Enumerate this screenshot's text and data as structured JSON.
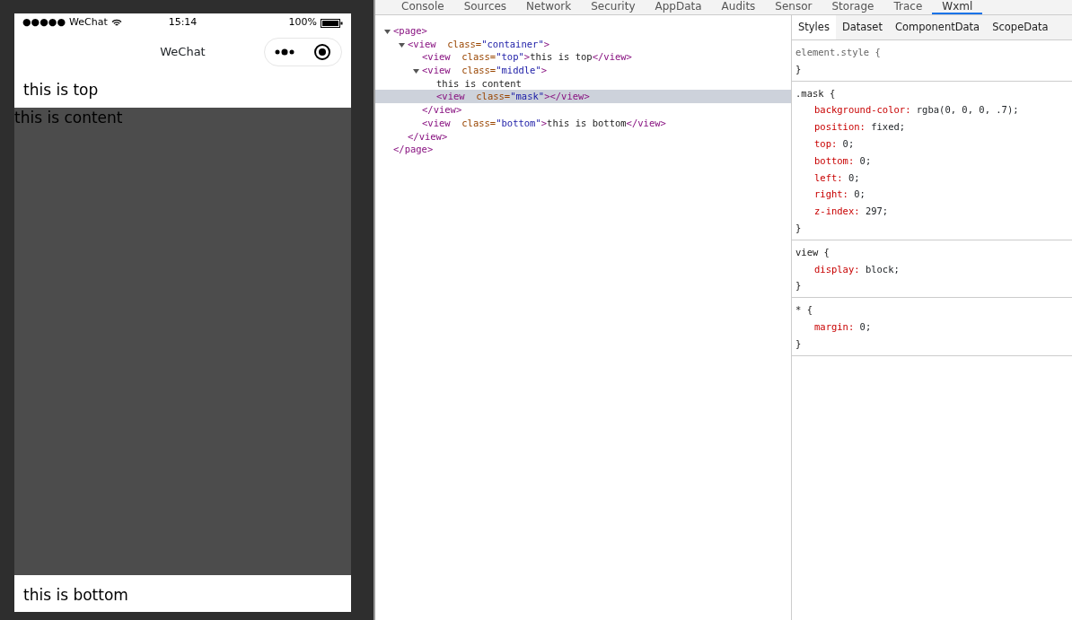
{
  "phone": {
    "status_bar": {
      "signal": "●●●●●",
      "carrier": "WeChat",
      "time": "15:14",
      "battery": "100%"
    },
    "nav_title": "WeChat",
    "top_text": "this is top",
    "content_text": "this is content",
    "bottom_text": "this is bottom"
  },
  "devtools": {
    "tabs": [
      {
        "label": "Console",
        "selected": false
      },
      {
        "label": "Sources",
        "selected": false
      },
      {
        "label": "Network",
        "selected": false
      },
      {
        "label": "Security",
        "selected": false
      },
      {
        "label": "AppData",
        "selected": false
      },
      {
        "label": "Audits",
        "selected": false
      },
      {
        "label": "Sensor",
        "selected": false
      },
      {
        "label": "Storage",
        "selected": false
      },
      {
        "label": "Trace",
        "selected": false
      },
      {
        "label": "Wxml",
        "selected": true
      }
    ],
    "tree": [
      {
        "expanded": true,
        "selected": false,
        "parts": [
          {
            "kind": "tag",
            "text": "<page>"
          }
        ],
        "closing": [
          {
            "kind": "tag",
            "text": "</page>"
          }
        ],
        "children": [
          {
            "expanded": true,
            "selected": false,
            "parts": [
              {
                "kind": "tag",
                "text": "<view"
              },
              {
                "kind": "attr",
                "text": "  class="
              },
              {
                "kind": "value",
                "text": "\"container\""
              },
              {
                "kind": "tag",
                "text": ">"
              }
            ],
            "closing": [
              {
                "kind": "tag",
                "text": "</view>"
              }
            ],
            "children": [
              {
                "selected": false,
                "parts": [
                  {
                    "kind": "tag",
                    "text": "<view"
                  },
                  {
                    "kind": "attr",
                    "text": "  class="
                  },
                  {
                    "kind": "value",
                    "text": "\"top\""
                  },
                  {
                    "kind": "tag",
                    "text": ">"
                  },
                  {
                    "kind": "text",
                    "text": "this is top"
                  },
                  {
                    "kind": "tag",
                    "text": "</view>"
                  }
                ]
              },
              {
                "expanded": true,
                "selected": false,
                "parts": [
                  {
                    "kind": "tag",
                    "text": "<view"
                  },
                  {
                    "kind": "attr",
                    "text": "  class="
                  },
                  {
                    "kind": "value",
                    "text": "\"middle\""
                  },
                  {
                    "kind": "tag",
                    "text": ">"
                  }
                ],
                "closing": [
                  {
                    "kind": "tag",
                    "text": "</view>"
                  }
                ],
                "children": [
                  {
                    "selected": false,
                    "parts": [
                      {
                        "kind": "text",
                        "text": "this is content"
                      }
                    ]
                  },
                  {
                    "selected": true,
                    "parts": [
                      {
                        "kind": "tag",
                        "text": "<view"
                      },
                      {
                        "kind": "attr",
                        "text": "  class="
                      },
                      {
                        "kind": "value",
                        "text": "\"mask\""
                      },
                      {
                        "kind": "tag",
                        "text": "></view>"
                      }
                    ]
                  }
                ]
              },
              {
                "selected": false,
                "parts": [
                  {
                    "kind": "tag",
                    "text": "<view"
                  },
                  {
                    "kind": "attr",
                    "text": "  class="
                  },
                  {
                    "kind": "value",
                    "text": "\"bottom\""
                  },
                  {
                    "kind": "tag",
                    "text": ">"
                  },
                  {
                    "kind": "text",
                    "text": "this is bottom"
                  },
                  {
                    "kind": "tag",
                    "text": "</view>"
                  }
                ]
              }
            ]
          }
        ]
      }
    ],
    "sub_tabs": [
      {
        "label": "Styles",
        "selected": true
      },
      {
        "label": "Dataset",
        "selected": false
      },
      {
        "label": "ComponentData",
        "selected": false
      },
      {
        "label": "ScopeData",
        "selected": false
      }
    ],
    "rules": [
      {
        "selector": "element.style {",
        "close": "}"
      },
      {
        "selector": ".mask {",
        "declarations": [
          {
            "property": "background-color:",
            "value": "rgba(0, 0, 0, .7);"
          },
          {
            "property": "position:",
            "value": "fixed;"
          },
          {
            "property": "top:",
            "value": "0;"
          },
          {
            "property": "bottom:",
            "value": "0;"
          },
          {
            "property": "left:",
            "value": "0;"
          },
          {
            "property": "right:",
            "value": "0;"
          },
          {
            "property": "z-index:",
            "value": "297;"
          }
        ],
        "close": "}"
      },
      {
        "selector": "view {",
        "declarations": [
          {
            "property": "display:",
            "value": "block;"
          }
        ],
        "close": "}"
      },
      {
        "selector": "* {",
        "declarations": [
          {
            "property": "margin:",
            "value": "0;"
          }
        ],
        "close": "}"
      }
    ]
  }
}
